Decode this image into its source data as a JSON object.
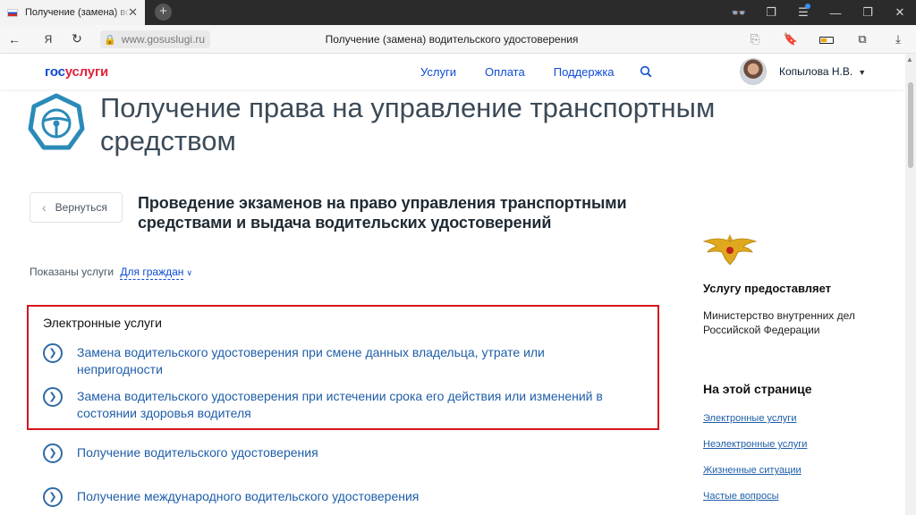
{
  "browser": {
    "tab_title": "Получение (замена) водительского удостоверения",
    "tab_close": "✕",
    "new_tab": "+",
    "url": "www.gosuslugi.ru",
    "page_title": "Получение (замена) водительского удостоверения",
    "yandex_icon": "Я"
  },
  "header": {
    "logo_gos": "гос",
    "logo_uslugi": "услуги",
    "nav": [
      "Услуги",
      "Оплата",
      "Поддержка"
    ],
    "user": "Копылова Н.В."
  },
  "main": {
    "title": "Получение права на управление транспортным средством",
    "back_label": "Вернуться",
    "subtitle": "Проведение экзаменов на право управления транспортными средствами и выдача водительских удостоверений",
    "filter_label": "Показаны услуги",
    "filter_value": "Для граждан",
    "electronic_title": "Электронные услуги",
    "services": [
      "Замена водительского удостоверения при смене данных владельца, утрате или непригодности",
      "Замена водительского удостоверения при истечении срока его действия или изменений в состоянии здоровья водителя",
      "Получение водительского удостоверения",
      "Получение международного водительского удостоверения"
    ]
  },
  "sidebar": {
    "provider_heading": "Услугу предоставляет",
    "provider": "Министерство внутренних дел Российской Федерации",
    "onpage_heading": "На этой странице",
    "onpage_links": [
      "Электронные услуги",
      "Неэлектронные услуги",
      "Жизненные ситуации",
      "Частые вопросы"
    ]
  },
  "colors": {
    "brand_blue": "#0d4cd3",
    "brand_red": "#e1243b",
    "highlight": "#d4171f",
    "link": "#1f5ea8"
  }
}
